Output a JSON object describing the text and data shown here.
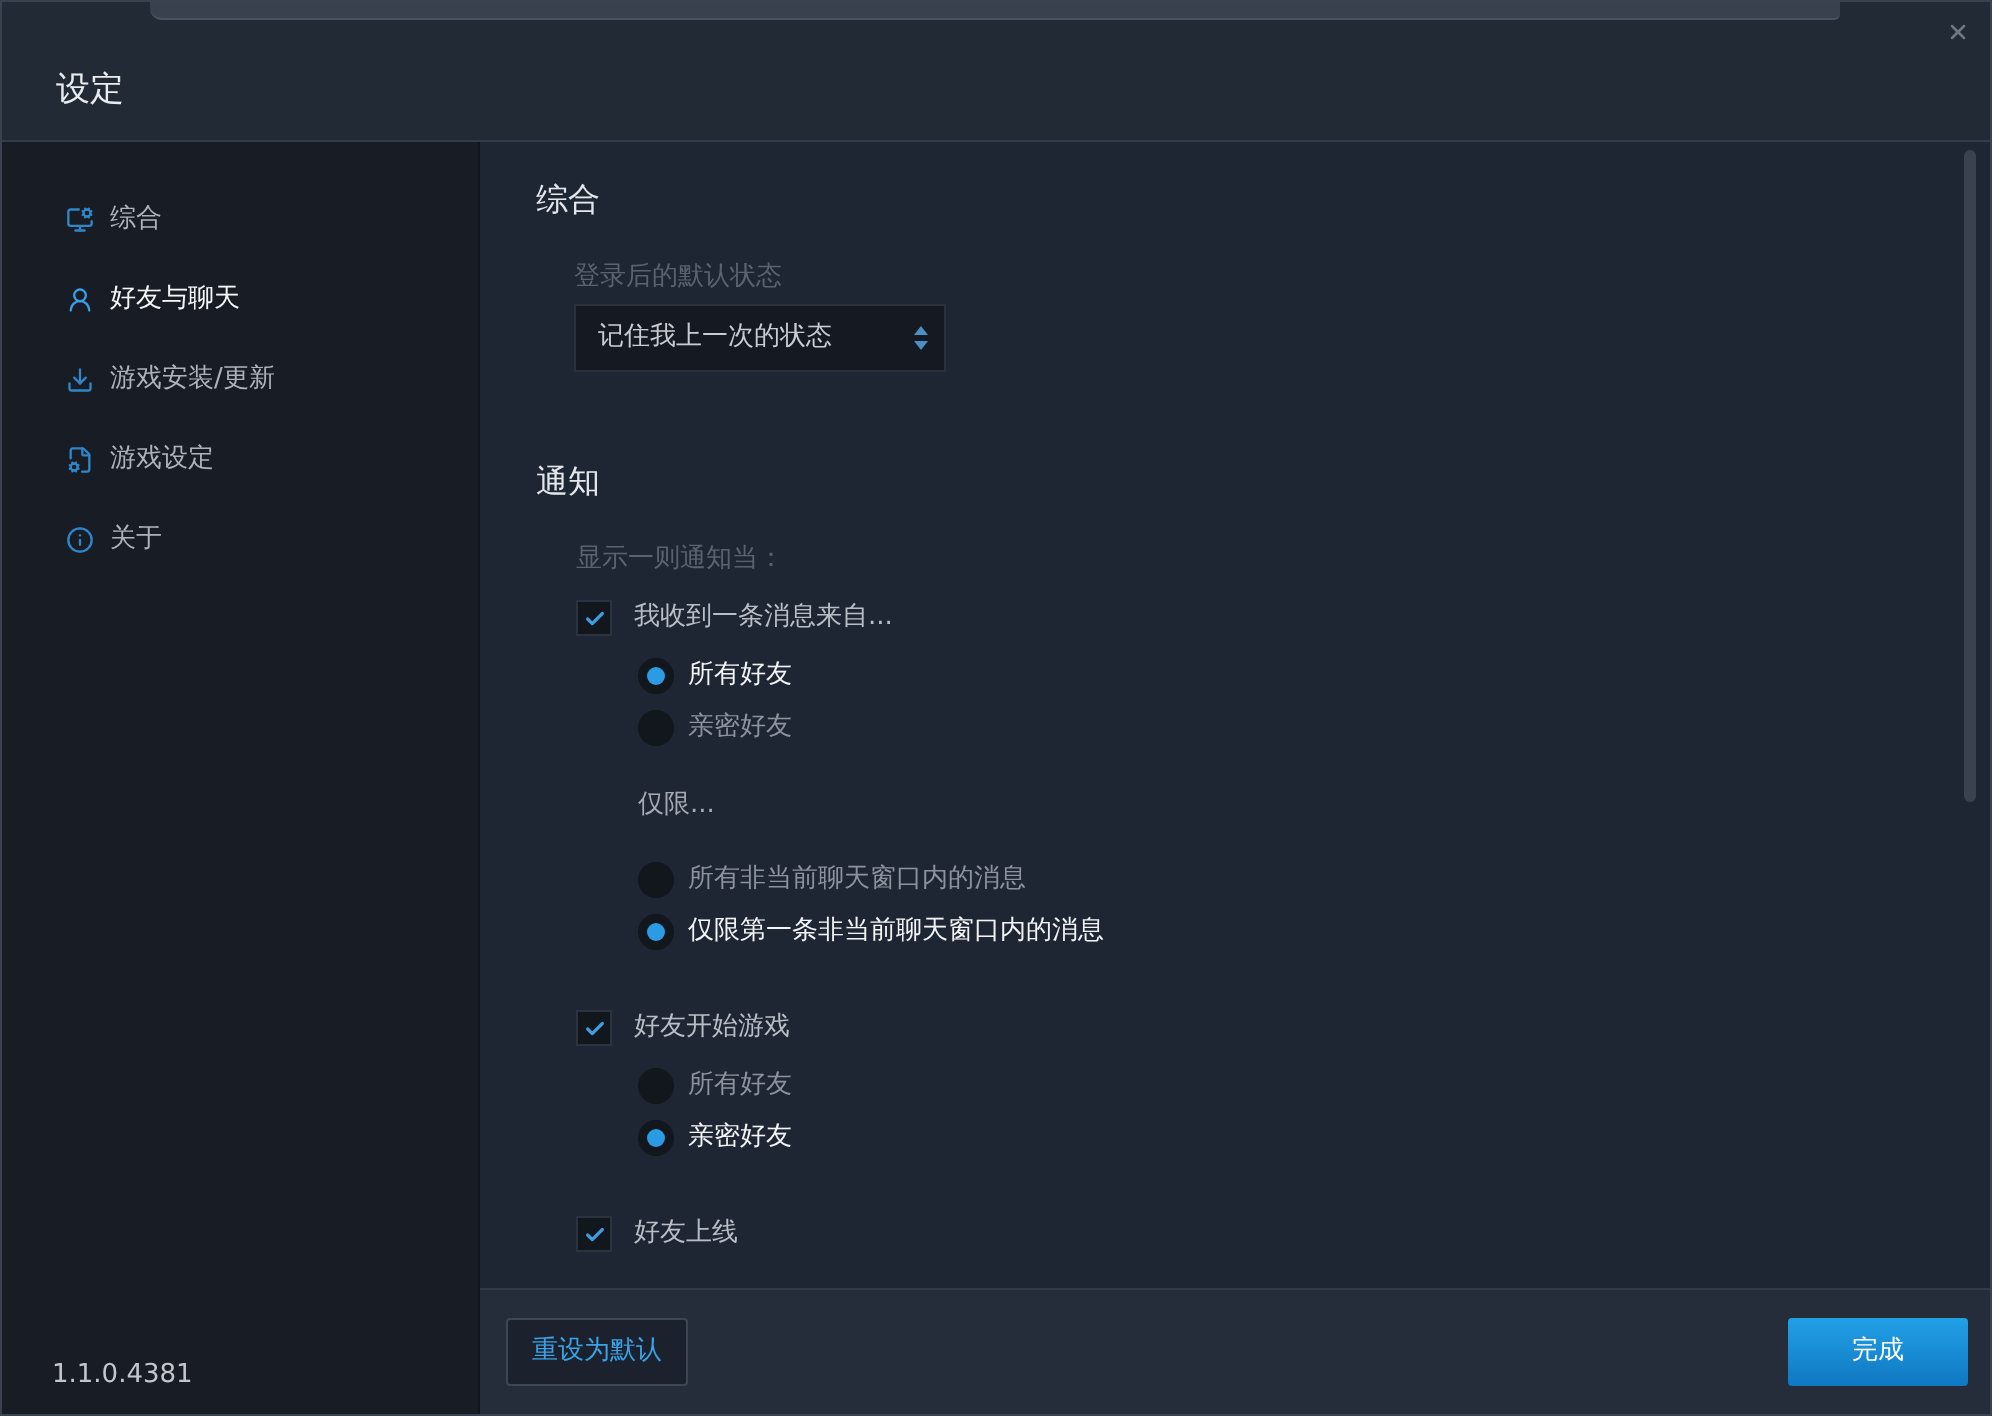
{
  "window": {
    "title": "设定"
  },
  "sidebar": {
    "items": [
      {
        "label": "综合",
        "selected": false
      },
      {
        "label": "好友与聊天",
        "selected": true
      },
      {
        "label": "游戏安装/更新",
        "selected": false
      },
      {
        "label": "游戏设定",
        "selected": false
      },
      {
        "label": "关于",
        "selected": false
      }
    ],
    "version": "1.1.0.4381"
  },
  "general": {
    "heading": "综合",
    "fields": [
      {
        "label": "登录后的默认状态",
        "value": "记住我上一次的状态"
      }
    ]
  },
  "notifications": {
    "heading": "通知",
    "hint": "显示一则通知当：",
    "items": [
      {
        "label": "我收到一条消息来自...",
        "checked": true,
        "groups": [
          {
            "options": [
              {
                "label": "所有好友",
                "selected": true
              },
              {
                "label": "亲密好友",
                "selected": false
              }
            ]
          },
          {
            "title": "仅限...",
            "options": [
              {
                "label": "所有非当前聊天窗口内的消息",
                "selected": false
              },
              {
                "label": "仅限第一条非当前聊天窗口内的消息",
                "selected": true
              }
            ]
          }
        ]
      },
      {
        "label": "好友开始游戏",
        "checked": true,
        "groups": [
          {
            "options": [
              {
                "label": "所有好友",
                "selected": false
              },
              {
                "label": "亲密好友",
                "selected": true
              }
            ]
          }
        ]
      },
      {
        "label": "好友上线",
        "checked": true
      }
    ]
  },
  "footer": {
    "buttons": [
      {
        "label": "重设为默认",
        "kind": "secondary"
      },
      {
        "label": "完成",
        "kind": "primary"
      }
    ]
  }
}
